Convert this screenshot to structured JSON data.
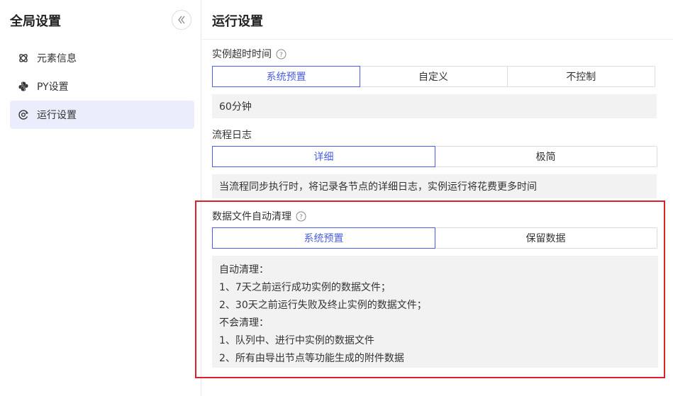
{
  "sidebar": {
    "title": "全局设置",
    "collapse_icon": "double-chevron-left-icon",
    "items": [
      {
        "label": "元素信息",
        "icon": "element-icon",
        "active": false
      },
      {
        "label": "PY设置",
        "icon": "python-icon",
        "active": false
      },
      {
        "label": "运行设置",
        "icon": "run-settings-icon",
        "active": true
      }
    ]
  },
  "main": {
    "title": "运行设置",
    "timeout": {
      "label": "实例超时时间",
      "options": [
        "系统预置",
        "自定义",
        "不控制"
      ],
      "selected": "系统预置",
      "value": "60分钟"
    },
    "log": {
      "label": "流程日志",
      "options": [
        "详细",
        "极简"
      ],
      "selected": "详细",
      "description": "当流程同步执行时，将记录各节点的详细日志，实例运行将花费更多时间"
    },
    "cleanup": {
      "label": "数据文件自动清理",
      "options": [
        "系统预置",
        "保留数据"
      ],
      "selected": "系统预置",
      "lines": [
        "自动清理：",
        "1、7天之前运行成功实例的数据文件；",
        "2、30天之前运行失败及终止实例的数据文件；",
        "不会清理：",
        "1、队列中、进行中实例的数据文件",
        "2、所有由导出节点等功能生成的附件数据"
      ]
    }
  },
  "colors": {
    "accent": "#4a5de0",
    "active_bg": "#eaedfb",
    "highlight": "#d8232a",
    "info_bg": "#f2f2f2"
  }
}
